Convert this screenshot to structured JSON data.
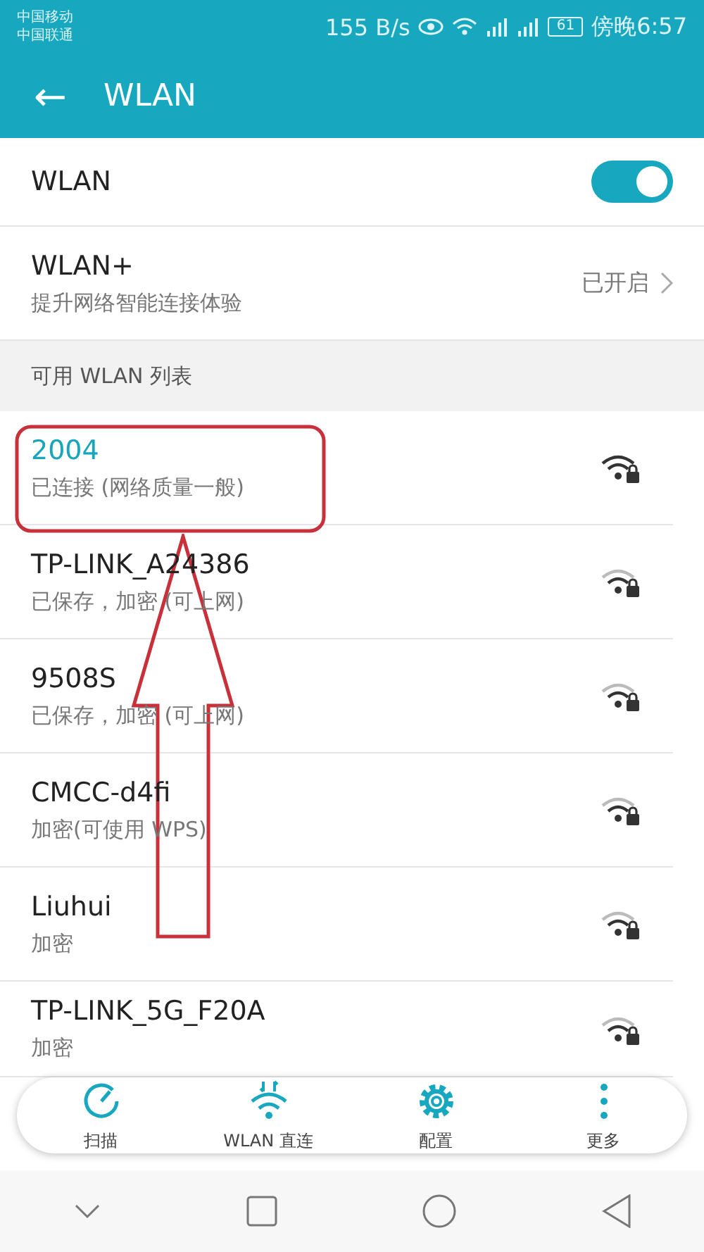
{
  "status_bar": {
    "carriers": [
      "中国移动",
      "中国联通"
    ],
    "speed": "155 B/s",
    "battery": "61",
    "time": "傍晚6:57"
  },
  "header": {
    "back": "←",
    "title": "WLAN"
  },
  "wlan_toggle": {
    "label": "WLAN",
    "on": true
  },
  "wlan_plus": {
    "label": "WLAN+",
    "subtitle": "提升网络智能连接体验",
    "value": "已开启"
  },
  "section_title": "可用 WLAN 列表",
  "networks": [
    {
      "name": "2004",
      "status": "已连接 (网络质量一般)",
      "selected": true,
      "kind": "full"
    },
    {
      "name": "TP-LINK_A24386",
      "status": "已保存，加密 (可上网)",
      "selected": false,
      "kind": "fair"
    },
    {
      "name": "9508S",
      "status": "已保存，加密 (可上网)",
      "selected": false,
      "kind": "fair"
    },
    {
      "name": "CMCC-d4fi",
      "status": "加密(可使用 WPS)",
      "selected": false,
      "kind": "fair"
    },
    {
      "name": "Liuhui",
      "status": "加密",
      "selected": false,
      "kind": "fair"
    },
    {
      "name": "TP-LINK_5G_F20A",
      "status": "加密",
      "selected": false,
      "kind": "fair"
    }
  ],
  "toolbar": [
    {
      "kind": "scan",
      "label": "扫描"
    },
    {
      "kind": "direct",
      "label": "WLAN 直连"
    },
    {
      "kind": "config",
      "label": "配置"
    },
    {
      "kind": "more",
      "label": "更多"
    }
  ]
}
